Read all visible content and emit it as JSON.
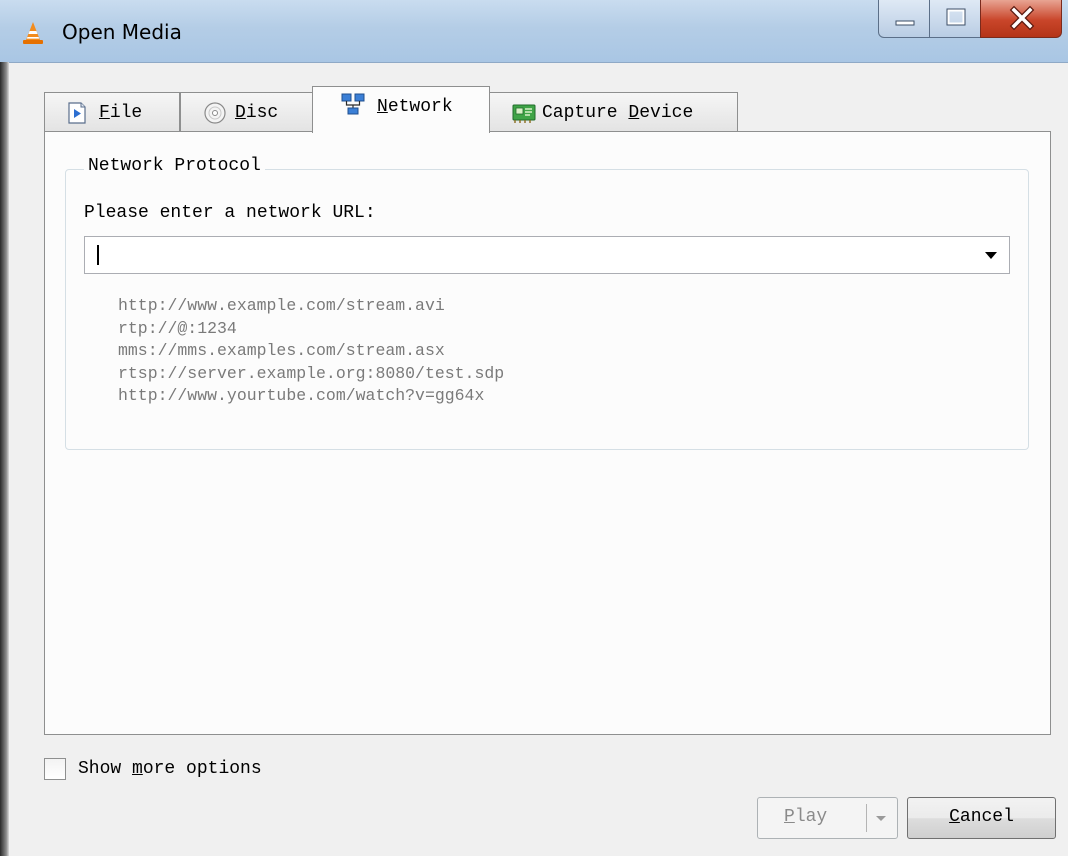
{
  "window": {
    "title": "Open Media"
  },
  "tabs": [
    {
      "id": "file",
      "label_accel": "F",
      "label_rest": "ile",
      "icon": "file-play-icon",
      "active": false
    },
    {
      "id": "disc",
      "label_accel": "D",
      "label_rest": "isc",
      "icon": "disc-icon",
      "active": false
    },
    {
      "id": "network",
      "label_accel": "N",
      "label_rest": "etwork",
      "icon": "network-icon",
      "active": true
    },
    {
      "id": "capture",
      "label_pre": "Capture ",
      "label_accel": "D",
      "label_rest": "evice",
      "icon": "capture-card-icon",
      "active": false
    }
  ],
  "network_panel": {
    "group_title": "Network Protocol",
    "url_label": "Please enter a network URL:",
    "url_value": "",
    "examples": [
      "http://www.example.com/stream.avi",
      "rtp://@:1234",
      "mms://mms.examples.com/stream.asx",
      "rtsp://server.example.org:8080/test.sdp",
      "http://www.yourtube.com/watch?v=gg64x"
    ]
  },
  "options": {
    "show_more_pre": "Show ",
    "show_more_accel": "m",
    "show_more_rest": "ore options",
    "checked": false
  },
  "buttons": {
    "play_accel": "P",
    "play_rest": "lay",
    "play_enabled": false,
    "cancel_accel": "C",
    "cancel_rest": "ancel"
  },
  "colors": {
    "accent_close": "#c9452a",
    "titlebar": "#b4cde6",
    "hint_text": "#7a7a7a"
  }
}
